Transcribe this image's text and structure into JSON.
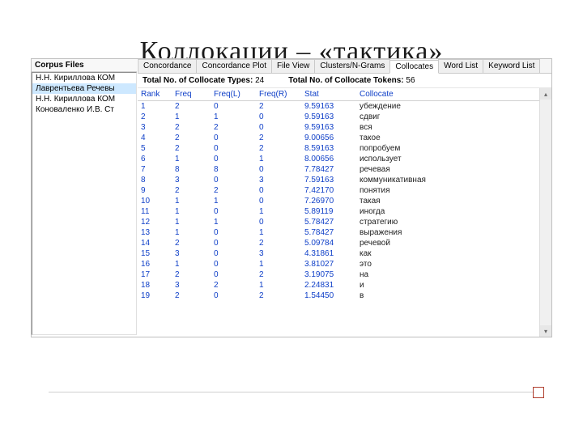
{
  "slide_title": "Коллокации – «тактика»",
  "left": {
    "header": "Corpus Files",
    "files": [
      "Н.Н. Кириллова КОМ",
      "Лаврентьева Речевы",
      "Н.Н. Кириллова КОМ",
      "Коноваленко И.В. Ст"
    ],
    "selected_index": 1
  },
  "tabs": [
    "Concordance",
    "Concordance Plot",
    "File View",
    "Clusters/N-Grams",
    "Collocates",
    "Word List",
    "Keyword List"
  ],
  "active_tab": 4,
  "stats": {
    "types_label": "Total No. of Collocate Types:",
    "types_value": "24",
    "tokens_label": "Total No. of Collocate Tokens:",
    "tokens_value": "56"
  },
  "columns": [
    "Rank",
    "Freq",
    "Freq(L)",
    "Freq(R)",
    "Stat",
    "Collocate"
  ],
  "rows": [
    {
      "rank": 1,
      "freq": 2,
      "fl": 0,
      "fr": 2,
      "stat": "9.59163",
      "col": "убеждение"
    },
    {
      "rank": 2,
      "freq": 1,
      "fl": 1,
      "fr": 0,
      "stat": "9.59163",
      "col": "сдвиг"
    },
    {
      "rank": 3,
      "freq": 2,
      "fl": 2,
      "fr": 0,
      "stat": "9.59163",
      "col": "вся"
    },
    {
      "rank": 4,
      "freq": 2,
      "fl": 0,
      "fr": 2,
      "stat": "9.00656",
      "col": "такое"
    },
    {
      "rank": 5,
      "freq": 2,
      "fl": 0,
      "fr": 2,
      "stat": "8.59163",
      "col": "попробуем"
    },
    {
      "rank": 6,
      "freq": 1,
      "fl": 0,
      "fr": 1,
      "stat": "8.00656",
      "col": "использует"
    },
    {
      "rank": 7,
      "freq": 8,
      "fl": 8,
      "fr": 0,
      "stat": "7.78427",
      "col": "речевая"
    },
    {
      "rank": 8,
      "freq": 3,
      "fl": 0,
      "fr": 3,
      "stat": "7.59163",
      "col": "коммуникативная"
    },
    {
      "rank": 9,
      "freq": 2,
      "fl": 2,
      "fr": 0,
      "stat": "7.42170",
      "col": "понятия"
    },
    {
      "rank": 10,
      "freq": 1,
      "fl": 1,
      "fr": 0,
      "stat": "7.26970",
      "col": "такая"
    },
    {
      "rank": 11,
      "freq": 1,
      "fl": 0,
      "fr": 1,
      "stat": "5.89119",
      "col": "иногда"
    },
    {
      "rank": 12,
      "freq": 1,
      "fl": 1,
      "fr": 0,
      "stat": "5.78427",
      "col": "стратегию"
    },
    {
      "rank": 13,
      "freq": 1,
      "fl": 0,
      "fr": 1,
      "stat": "5.78427",
      "col": "выражения"
    },
    {
      "rank": 14,
      "freq": 2,
      "fl": 0,
      "fr": 2,
      "stat": "5.09784",
      "col": "речевой"
    },
    {
      "rank": 15,
      "freq": 3,
      "fl": 0,
      "fr": 3,
      "stat": "4.31861",
      "col": "как"
    },
    {
      "rank": 16,
      "freq": 1,
      "fl": 0,
      "fr": 1,
      "stat": "3.81027",
      "col": "это"
    },
    {
      "rank": 17,
      "freq": 2,
      "fl": 0,
      "fr": 2,
      "stat": "3.19075",
      "col": "на"
    },
    {
      "rank": 18,
      "freq": 3,
      "fl": 2,
      "fr": 1,
      "stat": "2.24831",
      "col": "и"
    },
    {
      "rank": 19,
      "freq": 2,
      "fl": 0,
      "fr": 2,
      "stat": "1.54450",
      "col": "в"
    }
  ]
}
